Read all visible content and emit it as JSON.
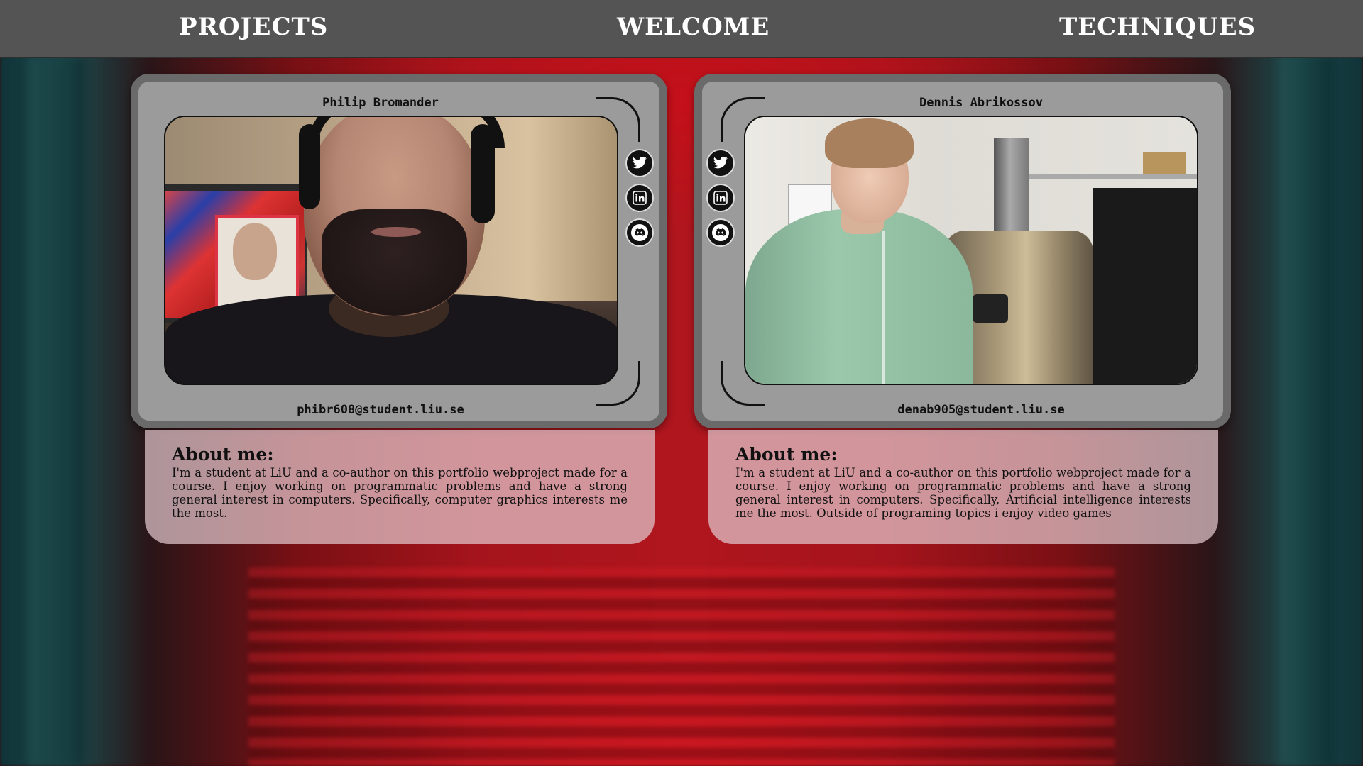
{
  "nav": {
    "projects": "PROJECTS",
    "welcome": "WELCOME",
    "techniques": "TECHNIQUES"
  },
  "profiles": [
    {
      "name": "Philip Bromander",
      "email": "phibr608@student.liu.se",
      "about_title": "About me:",
      "about_text": "I'm a student at LiU and a co-author on this portfolio webproject made for a course. I enjoy working on programmatic problems and have a strong general interest in computers. Specifically, computer graphics interests me the most.",
      "social": [
        "twitter-icon",
        "linkedin-icon",
        "discord-icon"
      ]
    },
    {
      "name": "Dennis Abrikossov",
      "email": "denab905@student.liu.se",
      "about_title": "About me:",
      "about_text": "I'm a student at LiU and a co-author on this portfolio webproject made for a course. I enjoy working on programmatic problems and have a strong general interest in computers. Specifically, Artificial intelligence interests me the most. Outside of programing topics i enjoy video games",
      "social": [
        "twitter-icon",
        "linkedin-icon",
        "discord-icon"
      ]
    }
  ],
  "colors": {
    "nav_bg": "#545454",
    "card_bg": "#9b9b9b",
    "card_border": "#6a6a6a",
    "about_bg": "#e2c8cd"
  }
}
